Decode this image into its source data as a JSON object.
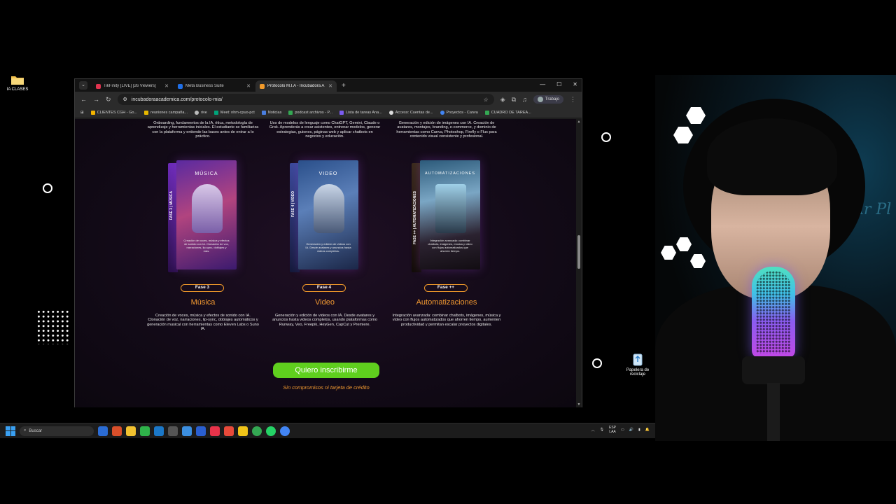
{
  "desktop": {
    "folder_label": "IA CLASES",
    "recycle_label": "Papelera de reciclaje"
  },
  "browser": {
    "tabs": [
      {
        "title": "TikFinity [LIVE] [26 Viewers]",
        "color": "#e0334f"
      },
      {
        "title": "Meta Business Suite",
        "color": "#1f6fe8"
      },
      {
        "title": "Protocolo M.I.A - Incubadora A",
        "color": "#f29a2a"
      }
    ],
    "url": "incubadoraacademica.com/protocolo-mia/",
    "profile_label": "Trabajo",
    "bookmarks": [
      {
        "label": "CLIENTES CGH - Go...",
        "color": "#f4b400"
      },
      {
        "label": "reuniones campaña...",
        "color": "#e6b800"
      },
      {
        "label": "rive",
        "color": "#bbbbbb"
      },
      {
        "label": "Meet: nhm-cpuo-pct",
        "color": "#00a37a"
      },
      {
        "label": "Noticias",
        "color": "#4a7fe0"
      },
      {
        "label": "podcast archivos - P...",
        "color": "#34a853"
      },
      {
        "label": "Lista de tareas Ana...",
        "color": "#7b5cf0"
      },
      {
        "label": "Acceso: Cuentas de...",
        "color": "#dddddd"
      },
      {
        "label": "Proyectos - Canva",
        "color": "#4285f4"
      },
      {
        "label": "CUADRO DE TAREA...",
        "color": "#34a853"
      }
    ]
  },
  "page": {
    "top_descriptions": [
      "Onboarding, fundamentos de la IA, ética, metodología de aprendizaje y herramientas iniciales. El estudiante se familiariza con la plataforma y entiende las bases antes de entrar a lo práctico.",
      "Uso de modelos de lenguaje como ChatGPT, Gemini, Claude o Grok. Aprenderás a crear asistentes, entrenar modelos, generar estrategias, guiones, páginas web y aplicar chatbots en negocios y educación.",
      "Generación y edición de imágenes con IA. Creación de avatares, montajes, branding, e-commerce, y dominio de herramientas como Canva, Photoshop, Firefly o Flux para contenido visual consistente y profesional."
    ],
    "phases": [
      {
        "box_title": "MÚSICA",
        "spine": "FASE 3 | MÚSICA",
        "box_blurb": "Creación de voces, música y efectos de sonido con IA. Clonación de voz, narraciones, lip-sync, doblajes y más.",
        "pill": "Fase 3",
        "title": "Música",
        "description": "Creación de voces, música y efectos de sonido con IA. Clonación de voz, narraciones, lip-sync, doblajes automáticos y generación musical con herramientas como Eleven Labs o Suno IA."
      },
      {
        "box_title": "VIDEO",
        "spine": "FASE 4 | VIDEO",
        "box_blurb": "Generación y edición de videos con IA. Desde avatares y anuncios hasta videos completos.",
        "pill": "Fase 4",
        "title": "Video",
        "description": "Generación y edición de videos con IA. Desde avatares y anuncios hasta videos completos, usando plataformas como Runway, Veo, Freepik, HeyGen, CapCut y Premiere."
      },
      {
        "box_title": "AUTOMATIZACIONES",
        "spine": "FASE ++ | AUTOMATIZACIONES",
        "box_blurb": "Integración avanzada: combinar chatbots, imágenes, música y video con flujos automatizados que ahorren tiempo.",
        "pill": "Fase ++",
        "title": "Automatizaciones",
        "description": "Integración avanzada: combinar chatbots, imágenes, música y video con flujos automatizados que ahorren tiempo, aumenten productividad y permitan escalar proyectos digitales."
      }
    ],
    "cta_label": "Quiero inscribirme",
    "cta_note": "Sin compromisos ni tarjeta de crédito"
  },
  "taskbar": {
    "search_placeholder": "Buscar",
    "lang_top": "ESP",
    "lang_bottom": "LAA",
    "apps": [
      "#2b6cd4",
      "#d94f2a",
      "#f2c230",
      "#4a9be8",
      "#2fb34a",
      "#1b78c8",
      "#555555",
      "#3c8fe0",
      "#2a5fd0",
      "#e8334a",
      "#e84a3a",
      "#f0c419",
      "#34a853",
      "#25d366",
      "#4285f4"
    ]
  },
  "webcam": {
    "neon_text": "Ar Pl"
  }
}
